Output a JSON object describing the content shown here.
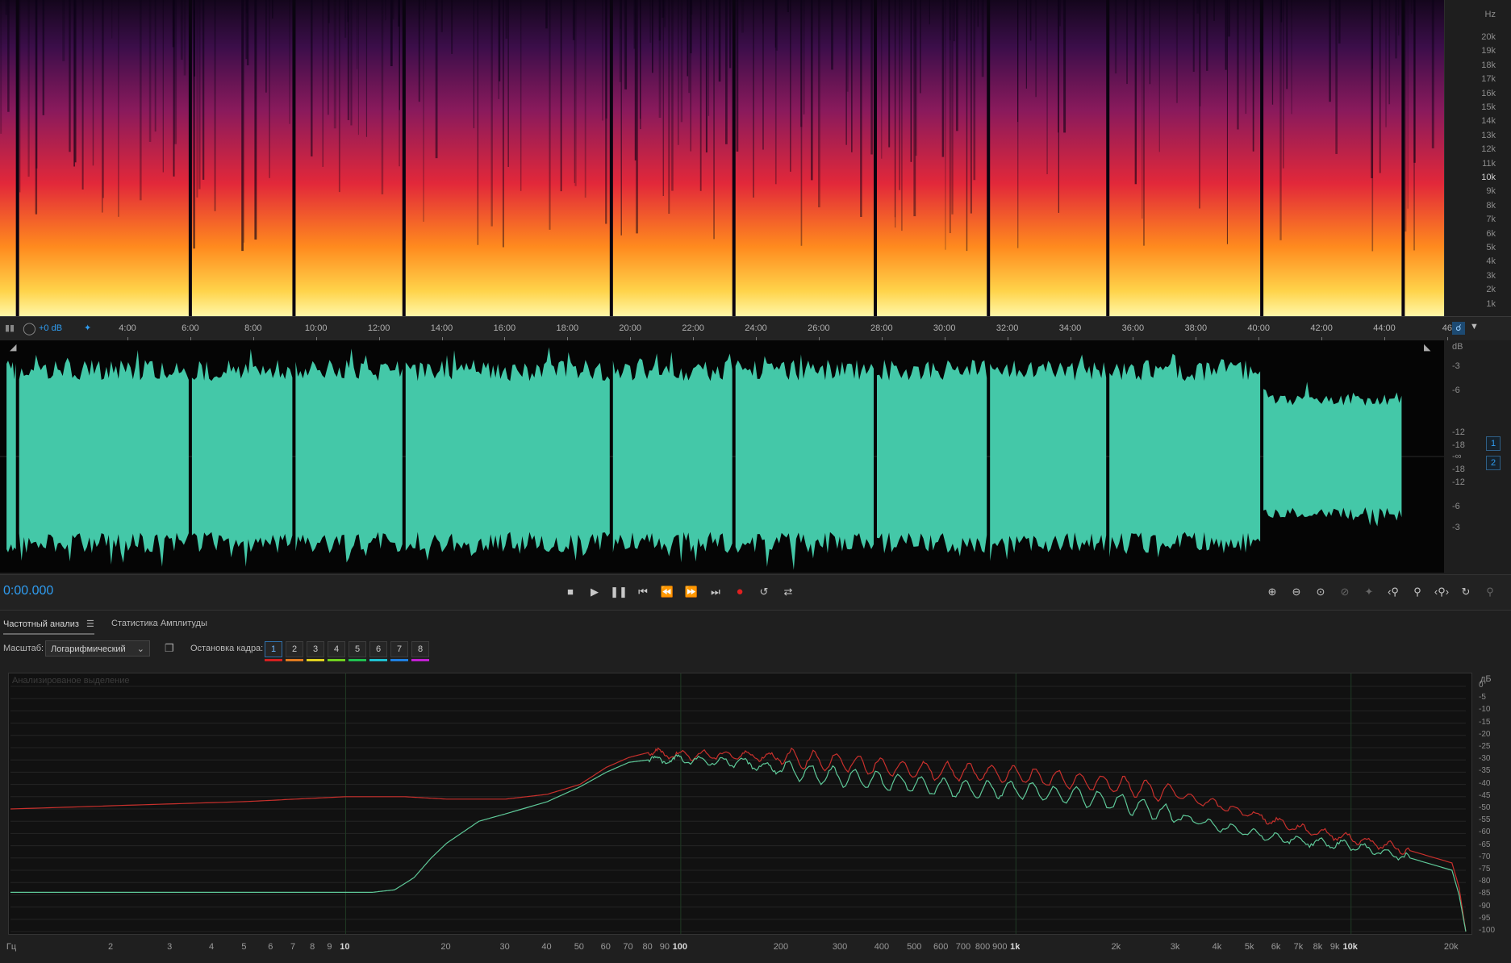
{
  "spectral": {
    "unit": "Hz",
    "freq_labels": [
      "20k",
      "19k",
      "18k",
      "17k",
      "16k",
      "15k",
      "14k",
      "13k",
      "12k",
      "11k",
      "10k",
      "9k",
      "8k",
      "7k",
      "6k",
      "5k",
      "4k",
      "3k",
      "2k",
      "1k"
    ]
  },
  "ruler": {
    "gain": "+0 dB",
    "time_labels": [
      "4:00",
      "6:00",
      "8:00",
      "10:00",
      "12:00",
      "14:00",
      "16:00",
      "18:00",
      "20:00",
      "22:00",
      "24:00",
      "26:00",
      "28:00",
      "30:00",
      "32:00",
      "34:00",
      "36:00",
      "38:00",
      "40:00",
      "42:00",
      "44:00",
      "46"
    ]
  },
  "waveform": {
    "unit": "dB",
    "db_labels": [
      "-3",
      "-6",
      "-12",
      "-18",
      "-∞",
      "-18",
      "-12",
      "-6",
      "-3"
    ],
    "channels": [
      "1",
      "2"
    ],
    "wave_color": "#44c8a8",
    "segment_boundaries_minutes": [
      0.5,
      6.0,
      9.3,
      12.8,
      19.4,
      23.3,
      27.8,
      31.4,
      35.2,
      40.1,
      44.6
    ]
  },
  "transport": {
    "time": "0:00.000",
    "buttons": [
      "stop",
      "play",
      "pause",
      "go-to-start",
      "rewind",
      "fast-forward",
      "go-to-end",
      "record",
      "loop",
      "skip-selection"
    ],
    "zoom_buttons": [
      "zoom-in-amplitude",
      "zoom-out-amplitude",
      "zoom-reset-amplitude",
      "zoom-out-full",
      "zoom-in-time",
      "zoom-out-time",
      "zoom-selection",
      "zoom-left",
      "zoom-right",
      "zoom-options"
    ]
  },
  "analysis": {
    "tabs": [
      "Частотный анализ",
      "Статистика Амплитуды"
    ],
    "scale_label": "Масштаб:",
    "scale_value": "Логарифмический",
    "hold_label": "Остановка кадра:",
    "hold_frames": [
      "1",
      "2",
      "3",
      "4",
      "5",
      "6",
      "7",
      "8"
    ],
    "hold_colors": [
      "#d42020",
      "#e07a20",
      "#e0d020",
      "#70d020",
      "#20c050",
      "#20c0d0",
      "#2080e0",
      "#c020d0"
    ],
    "plot_caption": "Анализированое выделение",
    "db_unit": "дБ",
    "db_labels": [
      "0",
      "-5",
      "-10",
      "-15",
      "-20",
      "-25",
      "-30",
      "-35",
      "-40",
      "-45",
      "-50",
      "-55",
      "-60",
      "-65",
      "-70",
      "-75",
      "-80",
      "-85",
      "-90",
      "-95",
      "-100"
    ],
    "x_unit": "Гц",
    "x_labels": [
      "2",
      "3",
      "4",
      "5",
      "6",
      "7",
      "8",
      "9",
      "10",
      "20",
      "30",
      "40",
      "50",
      "60",
      "70",
      "80",
      "90",
      "100",
      "200",
      "300",
      "400",
      "500",
      "600",
      "700",
      "800",
      "900",
      "1k",
      "2k",
      "3k",
      "4k",
      "5k",
      "6k",
      "7k",
      "8k",
      "9k",
      "10k",
      "20k"
    ]
  },
  "chart_data": {
    "type": "line",
    "xscale": "log",
    "xlim": [
      1,
      22000
    ],
    "ylim": [
      -100,
      0
    ],
    "x_unit": "Гц",
    "y_unit": "дБ",
    "series": [
      {
        "color": "#c8302c",
        "x": [
          1,
          5,
          10,
          15,
          20,
          30,
          40,
          50,
          60,
          70,
          80,
          100,
          150,
          200,
          300,
          500,
          700,
          1000,
          2000,
          3000,
          5000,
          7000,
          10000,
          15000,
          20000,
          21000,
          22000
        ],
        "y": [
          -50,
          -47,
          -45,
          -45,
          -46,
          -46,
          -44,
          -40,
          -33,
          -29,
          -27,
          -28,
          -28,
          -29,
          -31,
          -34,
          -35,
          -36,
          -40,
          -44,
          -52,
          -58,
          -62,
          -67,
          -72,
          -82,
          -100
        ]
      },
      {
        "color": "#5ec898",
        "x": [
          1,
          5,
          10,
          12,
          14,
          16,
          18,
          20,
          25,
          30,
          40,
          50,
          60,
          70,
          80,
          100,
          150,
          200,
          300,
          500,
          700,
          1000,
          2000,
          3000,
          5000,
          7000,
          10000,
          15000,
          20000,
          21000,
          22000
        ],
        "y": [
          -84,
          -84,
          -84,
          -84,
          -83,
          -78,
          -70,
          -64,
          -55,
          -52,
          -47,
          -41,
          -35,
          -31,
          -30,
          -30,
          -31,
          -34,
          -37,
          -40,
          -42,
          -42,
          -47,
          -53,
          -60,
          -63,
          -65,
          -70,
          -75,
          -85,
          -100
        ]
      }
    ]
  }
}
